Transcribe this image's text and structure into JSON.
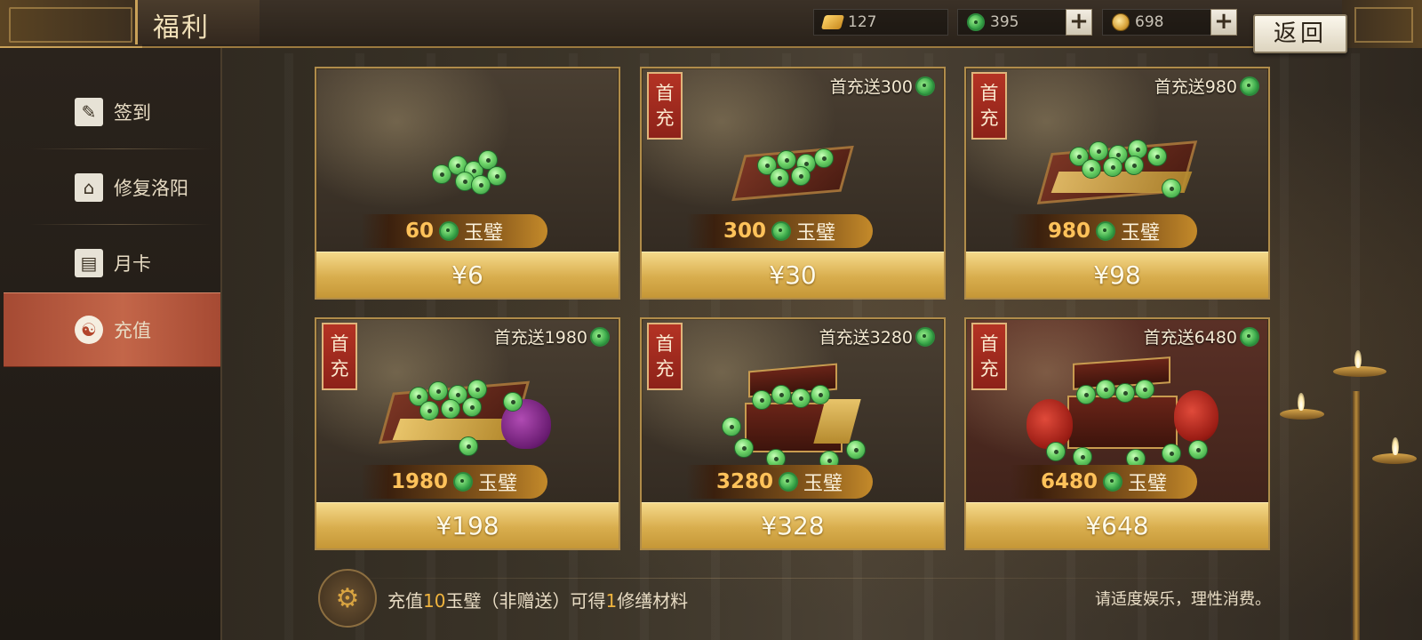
{
  "header": {
    "title": "福利",
    "back_label": "返回"
  },
  "currencies": [
    {
      "icon": "gold-bar-icon",
      "value": "127"
    },
    {
      "icon": "jade-icon",
      "value": "395",
      "has_plus": true
    },
    {
      "icon": "coin-icon",
      "value": "698",
      "has_plus": true
    }
  ],
  "sidebar": {
    "items": [
      {
        "label": "签到",
        "icon": "sign-in-icon"
      },
      {
        "label": "修复洛阳",
        "icon": "building-icon"
      },
      {
        "label": "月卡",
        "icon": "month-card-icon"
      },
      {
        "label": "充值",
        "icon": "recharge-icon",
        "active": true
      }
    ]
  },
  "products": [
    {
      "amount": "60",
      "unit": "玉璧",
      "price": "¥6",
      "first_tag": "",
      "bonus": ""
    },
    {
      "amount": "300",
      "unit": "玉璧",
      "price": "¥30",
      "first_tag": "首充",
      "bonus": "首充送300"
    },
    {
      "amount": "980",
      "unit": "玉璧",
      "price": "¥98",
      "first_tag": "首充",
      "bonus": "首充送980"
    },
    {
      "amount": "1980",
      "unit": "玉璧",
      "price": "¥198",
      "first_tag": "首充",
      "bonus": "首充送1980"
    },
    {
      "amount": "3280",
      "unit": "玉璧",
      "price": "¥328",
      "first_tag": "首充",
      "bonus": "首充送3280"
    },
    {
      "amount": "6480",
      "unit": "玉璧",
      "price": "¥648",
      "first_tag": "首充",
      "bonus": "首充送6480"
    }
  ],
  "first_tag_chars": [
    "首",
    "充"
  ],
  "footer": {
    "text_pre": "充值",
    "text_num1": "10",
    "text_mid": "玉璧（非赠送）可得",
    "text_num2": "1",
    "text_post": "修缮材料",
    "note": "请适度娱乐，理性消费。"
  },
  "colors": {
    "accent_gold": "#c9a158",
    "active_red": "#b3452b",
    "jade_green": "#3aa84a",
    "amount_orange": "#ffc25a"
  }
}
